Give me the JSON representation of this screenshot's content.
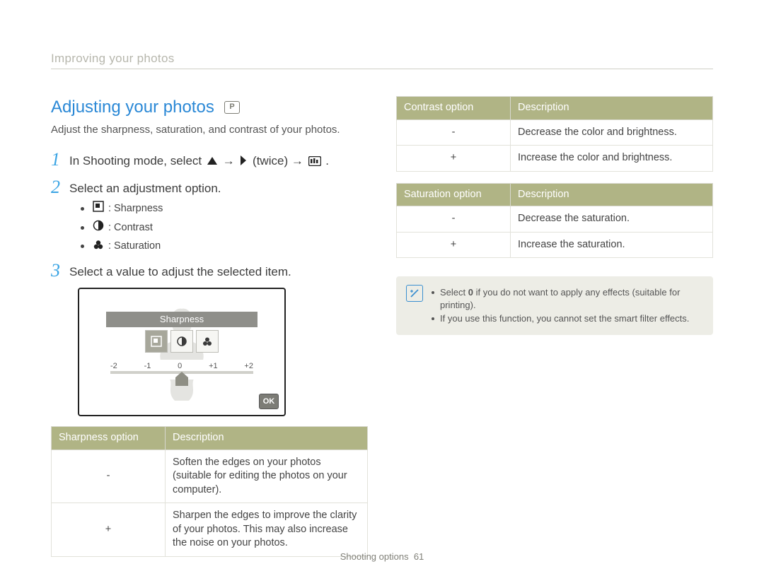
{
  "breadcrumb": "Improving your photos",
  "section_title": "Adjusting your photos",
  "mode_icon_label": "P",
  "intro": "Adjust the sharpness, saturation, and contrast of your photos.",
  "steps": {
    "s1": {
      "num": "1",
      "pre": "In Shooting mode, select ",
      "mid": " → ",
      "twice": " (twice) → ",
      "post": "."
    },
    "s2": {
      "num": "2",
      "text": "Select an adjustment option."
    },
    "s3": {
      "num": "3",
      "text": "Select a value to adjust the selected item."
    }
  },
  "options": {
    "sharpness": ": Sharpness",
    "contrast": ": Contrast",
    "saturation": ": Saturation"
  },
  "screenshot": {
    "label": "Sharpness",
    "ticks": [
      "-2",
      "-1",
      "0",
      "+1",
      "+2"
    ],
    "ok": "OK"
  },
  "tables": {
    "sharpness": {
      "h1": "Sharpness option",
      "h2": "Description",
      "rows": [
        {
          "sym": "-",
          "desc": "Soften the edges on your photos (suitable for editing the photos on your computer)."
        },
        {
          "sym": "+",
          "desc": "Sharpen the edges to improve the clarity of your photos. This may also increase the noise on your photos."
        }
      ]
    },
    "contrast": {
      "h1": "Contrast option",
      "h2": "Description",
      "rows": [
        {
          "sym": "-",
          "desc": "Decrease the color and brightness."
        },
        {
          "sym": "+",
          "desc": "Increase the color and brightness."
        }
      ]
    },
    "saturation": {
      "h1": "Saturation option",
      "h2": "Description",
      "rows": [
        {
          "sym": "-",
          "desc": "Decrease the saturation."
        },
        {
          "sym": "+",
          "desc": "Increase the saturation."
        }
      ]
    }
  },
  "note": {
    "line1_pre": "Select ",
    "line1_bold": "0",
    "line1_post": " if you do not want to apply any effects (suitable for printing).",
    "line2": "If you use this function, you cannot set the smart filter effects."
  },
  "footer": {
    "label": "Shooting options",
    "page": "61"
  }
}
